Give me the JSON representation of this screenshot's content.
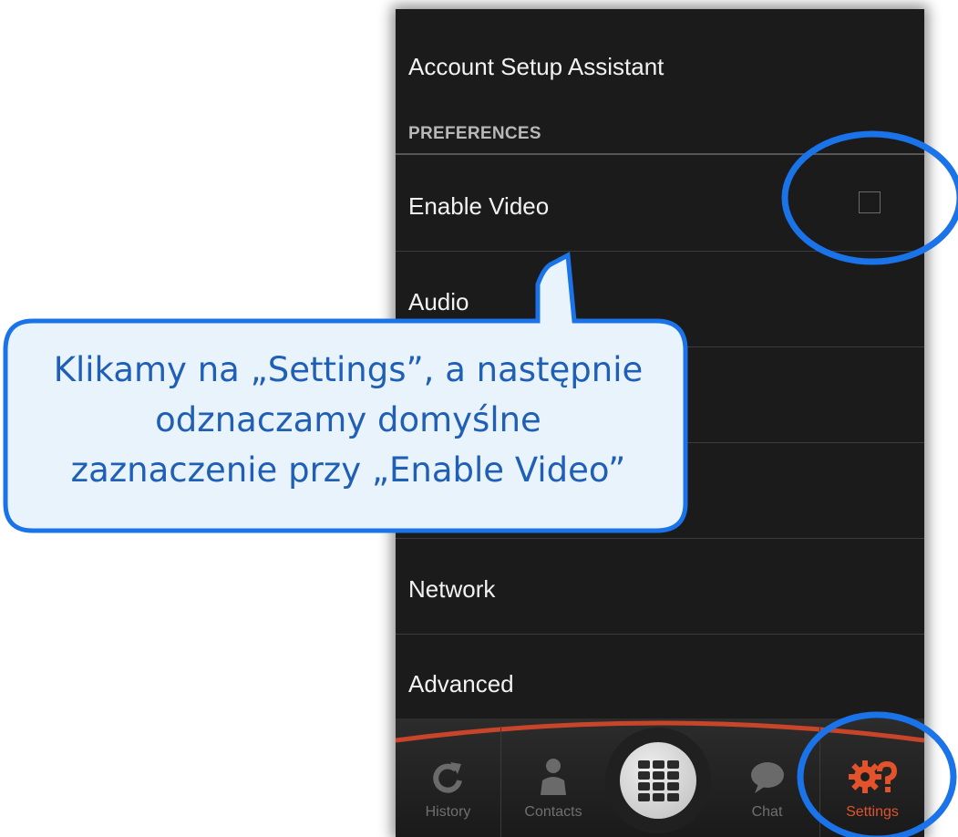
{
  "app": {
    "rows": [
      {
        "label": "Account Setup Assistant"
      },
      {
        "label": "Enable Video"
      },
      {
        "label": "Audio"
      },
      {
        "label": "Network"
      },
      {
        "label": "Advanced"
      }
    ],
    "section_header": "PREFERENCES",
    "enable_video_checked": false
  },
  "tabs": [
    {
      "label": "History",
      "icon": "refresh-icon"
    },
    {
      "label": "Contacts",
      "icon": "person-icon"
    },
    {
      "label": "",
      "icon": "dialpad-icon"
    },
    {
      "label": "Chat",
      "icon": "chat-bubble-icon"
    },
    {
      "label": "Settings",
      "icon": "gear-question-icon"
    }
  ],
  "annotation": {
    "line1": "Klikamy na „Settings”, a następnie",
    "line2": "odznaczamy  domyślne",
    "line3": "zaznaczenie przy „Enable Video”"
  },
  "colors": {
    "callout_border": "#1a73e8",
    "callout_text": "#1f5fb5",
    "settings_active": "#e2532c",
    "screen_bg": "#1b1b1b"
  }
}
